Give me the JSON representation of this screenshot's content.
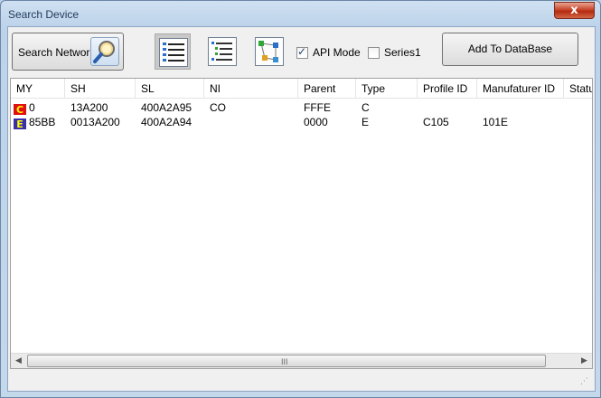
{
  "window": {
    "title": "Search Device",
    "close_glyph": "x"
  },
  "toolbar": {
    "search_label": "Search Network",
    "search_icon": "magnifier-icon",
    "views": [
      {
        "name": "detail-view",
        "icon": "list-detail-icon",
        "active": true
      },
      {
        "name": "list-view",
        "icon": "list-icon",
        "active": false
      },
      {
        "name": "tree-view",
        "icon": "network-tree-icon",
        "active": false
      }
    ],
    "api_mode": {
      "label": "API Mode",
      "checked": true
    },
    "series1": {
      "label": "Series1",
      "checked": false
    },
    "add_label": "Add To DataBase"
  },
  "table": {
    "columns": [
      "MY",
      "SH",
      "SL",
      "NI",
      "Parent",
      "Type",
      "Profile ID",
      "Manufaturer ID",
      "Status"
    ],
    "rows": [
      {
        "badge": "C",
        "badge_color": "#e01010",
        "cells": [
          "0",
          "13A200",
          "400A2A95",
          "CO",
          "FFFE",
          "C",
          "",
          "",
          ""
        ]
      },
      {
        "badge": "E",
        "badge_color": "#3a2fa8",
        "cells": [
          "85BB",
          "0013A200",
          "400A2A94",
          "",
          "0000",
          "E",
          "C105",
          "101E",
          ""
        ]
      }
    ]
  },
  "scrollbar": {
    "left_arrow": "◀",
    "right_arrow": "▶",
    "grip": "III"
  },
  "colors": {
    "badge_coordinator": "#e01010",
    "badge_end_device": "#3a2fa8",
    "badge_text": "#ffff00"
  }
}
